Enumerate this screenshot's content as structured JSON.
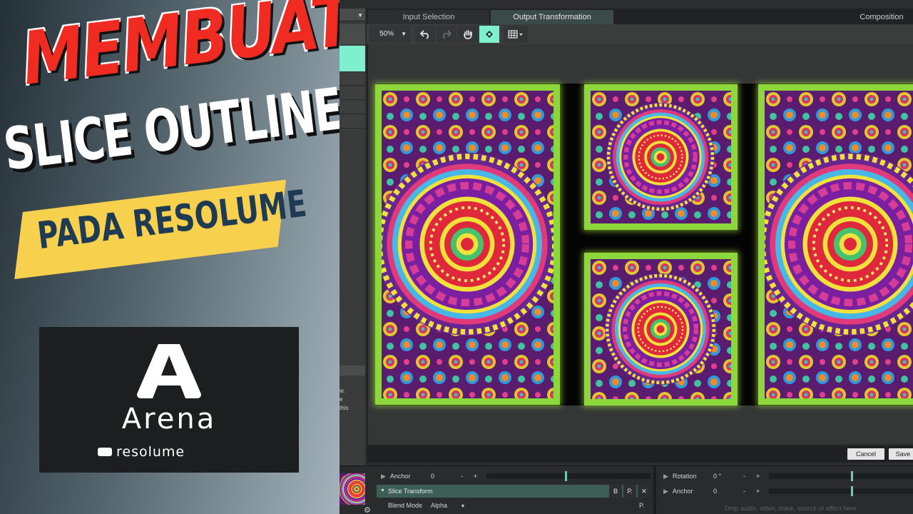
{
  "banner": {
    "title_line1": "MEMBUAT",
    "title_line2": "SLICE OUTLINE",
    "title_line3": "PADA RESOLUME",
    "logo_word": "Arena",
    "logo_brand": "resolume",
    "colors": {
      "title_red": "#f02b22",
      "ribbon_yellow": "#f7d04e",
      "ribbon_text": "#1f3b53"
    }
  },
  "app": {
    "tabs": {
      "input_selection": "Input Selection",
      "output_transformation": "Output Transformation",
      "composition": "Composition"
    },
    "toolbar": {
      "zoom": "50%",
      "undo_icon": "undo-icon",
      "redo_icon": "redo-icon",
      "hand_icon": "hand-icon",
      "transform_icon": "transform-tool-icon",
      "grid_icon": "grid-icon"
    },
    "side_help_text": [
      "w.",
      "e",
      "this"
    ],
    "buttons": {
      "cancel": "Cancel",
      "save": "Save"
    },
    "accent": "#7ff0cd",
    "slice_outline_color": "#8bd73c"
  },
  "params": {
    "anchor_left": {
      "label": "Anchor",
      "value": "0",
      "minus": "-",
      "plus": "+"
    },
    "slice_transform": {
      "label": "Slice Transform",
      "b": "B",
      "p": "P.",
      "x": "✕"
    },
    "blend_mode": {
      "label": "Blend Mode",
      "value": "Alpha",
      "p": "P."
    },
    "rotation": {
      "label": "Rotation",
      "value": "0 °",
      "minus": "-",
      "plus": "+"
    },
    "anchor_right": {
      "label": "Anchor",
      "value": "0",
      "minus": "-",
      "plus": "+"
    },
    "drop_hint": "Drop audio, video, mask, source or effect here"
  }
}
